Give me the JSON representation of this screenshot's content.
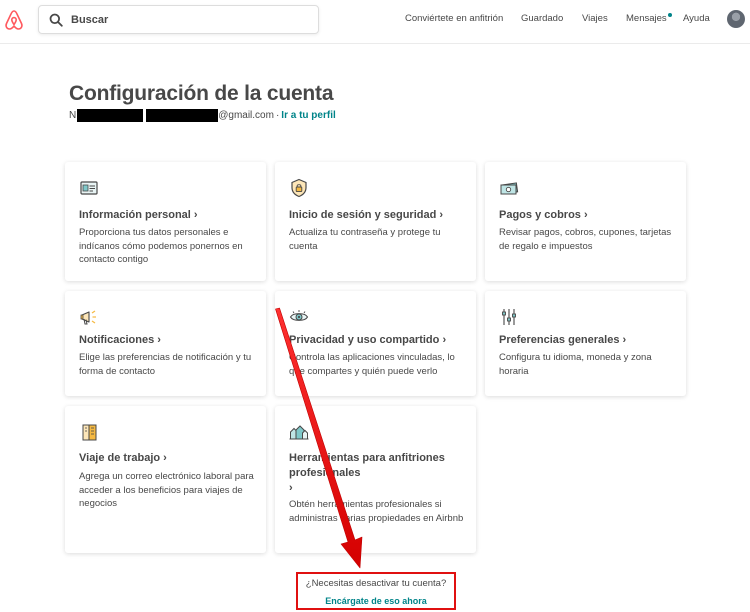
{
  "header": {
    "search_placeholder": "Buscar",
    "nav": {
      "host": "Conviértete en anfitrión",
      "saved": "Guardado",
      "trips": "Viajes",
      "messages": "Mensajes",
      "help": "Ayuda"
    },
    "brand_color": "#ff5a5f",
    "accent_color": "#008489"
  },
  "page": {
    "title": "Configuración de la cuenta",
    "email_initial": "N",
    "email_domain": "@gmail.com",
    "separator": "·",
    "profile_link": "Ir a tu perfil"
  },
  "cards": [
    {
      "icon": "id-card-icon",
      "title": "Información personal",
      "description": "Proporciona tus datos personales e indícanos cómo podemos ponernos en contacto contigo"
    },
    {
      "icon": "shield-icon",
      "title": "Inicio de sesión y seguridad",
      "description": "Actualiza tu contraseña y protege tu cuenta"
    },
    {
      "icon": "money-icon",
      "title": "Pagos y cobros",
      "description": "Revisar pagos, cobros, cupones, tarjetas de regalo e impuestos"
    },
    {
      "icon": "megaphone-icon",
      "title": "Notificaciones",
      "description": "Elige las preferencias de notificación y tu forma de contacto"
    },
    {
      "icon": "eye-icon",
      "title": "Privacidad y uso compartido",
      "description": "Controla las aplicaciones vinculadas, lo que compartes y quién puede verlo"
    },
    {
      "icon": "sliders-icon",
      "title": "Preferencias generales",
      "description": "Configura tu idioma, moneda y zona horaria"
    },
    {
      "icon": "briefcase-icon",
      "title": "Viaje de trabajo",
      "description": "Agrega un correo electrónico laboral para acceder a los beneficios para viajes de negocios"
    },
    {
      "icon": "buildings-icon",
      "title": "Herramientas para anfitriones profesionales",
      "description": "Obtén herramientas profesionales si administras varias propiedades en Airbnb"
    }
  ],
  "chevron": "›",
  "deactivate": {
    "question": "¿Necesitas desactivar tu cuenta?",
    "link": "Encárgate de eso ahora",
    "highlight_color": "#e01010"
  }
}
